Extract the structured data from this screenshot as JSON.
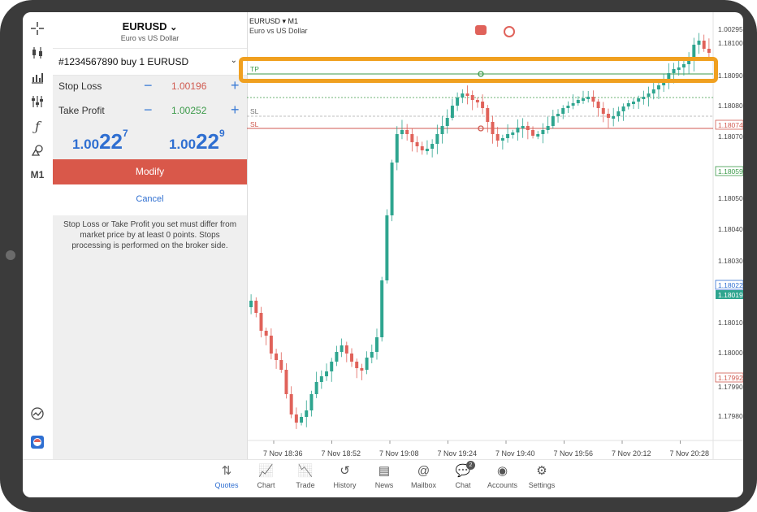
{
  "panel": {
    "symbol": "EURUSD",
    "symbol_chevron": "⌄",
    "symbol_desc": "Euro vs US Dollar",
    "order": "#1234567890   buy 1 EURUSD",
    "order_chevron": "⌄",
    "stop_loss": {
      "label": "Stop Loss",
      "minus": "−",
      "value": "1.00196",
      "plus": "+"
    },
    "take_profit": {
      "label": "Take Profit",
      "minus": "−",
      "value": "1.00252",
      "plus": "+"
    },
    "bid": {
      "prefix": "1.00",
      "big": "22",
      "sup": "7"
    },
    "ask": {
      "prefix": "1.00",
      "big": "22",
      "sup": "9"
    },
    "modify_label": "Modify",
    "cancel_label": "Cancel",
    "note": "Stop Loss or Take Profit you set must differ from market price by at least 0 points. Stops processing is performed on the broker side."
  },
  "chart": {
    "title": "EURUSD ▾ M1",
    "subtitle": "Euro vs US Dollar",
    "price_labels": [
      "1.00295",
      "1.18100",
      "1.18090",
      "1.18080",
      "1.18074",
      "1.18070",
      "1.18059",
      "1.18050",
      "1.18040",
      "1.18030",
      "1.18022",
      "1.18019",
      "1.18010",
      "1.18000",
      "1.17992",
      "1.17990",
      "1.17980"
    ],
    "time_labels": [
      "7 Nov 18:36",
      "7 Nov 18:52",
      "7 Nov 19:08",
      "7 Nov 19:24",
      "7 Nov 19:40",
      "7 Nov 19:56",
      "7 Nov 20:12",
      "7 Nov 20:28"
    ],
    "tp_label": "TP",
    "sl_labels": [
      "SL",
      "SL"
    ],
    "colors": {
      "up": "#2ea58f",
      "down": "#e0625a",
      "tp": "#3c9a4a",
      "sl": "#d05a50",
      "highlight": "#f0a020"
    }
  },
  "toolbar": {
    "timeframe": "M1"
  },
  "nav": [
    {
      "label": "Quotes",
      "icon": "quotes-icon"
    },
    {
      "label": "Chart",
      "icon": "chart-icon"
    },
    {
      "label": "Trade",
      "icon": "trade-icon"
    },
    {
      "label": "History",
      "icon": "history-icon"
    },
    {
      "label": "News",
      "icon": "news-icon"
    },
    {
      "label": "Mailbox",
      "icon": "mailbox-icon"
    },
    {
      "label": "Chat",
      "icon": "chat-icon",
      "badge": "2"
    },
    {
      "label": "Accounts",
      "icon": "accounts-icon"
    },
    {
      "label": "Settings",
      "icon": "settings-icon"
    }
  ]
}
